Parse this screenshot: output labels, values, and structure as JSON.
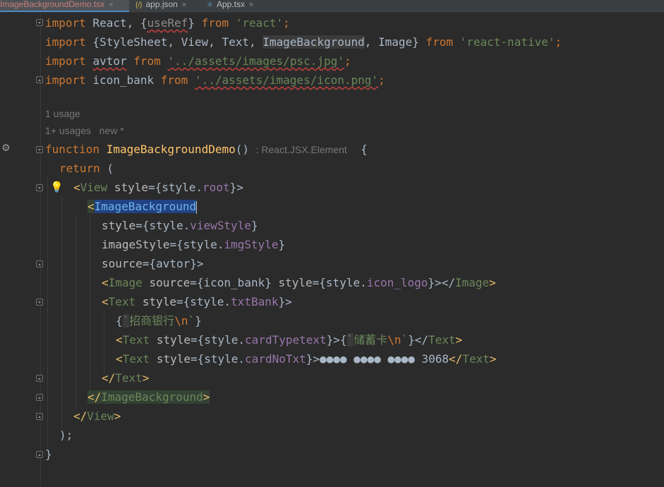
{
  "tabs": [
    {
      "label": "ImageBackgroundDemo.tsx",
      "active": true
    },
    {
      "label": "app.json",
      "active": false
    },
    {
      "label": "App.tsx",
      "active": false
    }
  ],
  "tab_close": "×",
  "hints": {
    "usage_1": "1 usage",
    "usage_2": "1+ usages",
    "new_author": "new *",
    "return_type": ": React.JSX.Element"
  },
  "code": {
    "l1": {
      "kw1": "import",
      "t1": " React, {",
      "id": "useRef",
      "t2": "} ",
      "kw2": "from",
      "t3": " ",
      "str": "'react'",
      "end": ";"
    },
    "l2": {
      "kw1": "import",
      "t1": " {StyleSheet, View, Text, ",
      "id": "ImageBackground",
      "t2": ", Image} ",
      "kw2": "from",
      "t3": " ",
      "str": "'react-native'",
      "end": ";"
    },
    "l3": {
      "kw1": "import",
      "t1": " ",
      "id": "avtor",
      "t2": " ",
      "kw2": "from",
      "t3": " ",
      "str": "'../assets/images/psc.jpg'",
      "end": ";"
    },
    "l4": {
      "kw1": "import",
      "t1": " icon_bank ",
      "kw2": "from",
      "t3": " ",
      "str": "'../assets/images/icon.png'",
      "end": ";"
    },
    "l5": {
      "kw": "function",
      "sp": " ",
      "fn": "ImageBackgroundDemo",
      "paren": "()",
      "brace": "{"
    },
    "l6": {
      "kw": "return",
      "rest": " ("
    },
    "l7": {
      "lt": "<",
      "tag": "View",
      "sp": " ",
      "attr": "style",
      "eq": "={style.",
      "prop": "root",
      "end": "}>"
    },
    "l8": {
      "lt": "<",
      "tag": "ImageBackground"
    },
    "l9": {
      "attr": "style",
      "eq": "={style.",
      "prop": "viewStyle",
      "end": "}"
    },
    "l10": {
      "attr": "imageStyle",
      "eq": "={style.",
      "prop": "imgStyle",
      "end": "}"
    },
    "l11": {
      "attr": "source",
      "eq": "={avtor}>"
    },
    "l12": {
      "lt": "<",
      "tag": "Image",
      "sp": " ",
      "attr1": "source",
      "eq1": "={icon_bank} ",
      "attr2": "style",
      "eq2": "={style.",
      "prop": "icon_logo",
      "mid": "}></",
      "tag2": "Image",
      "end": ">"
    },
    "l13": {
      "lt": "<",
      "tag": "Text",
      "sp": " ",
      "attr": "style",
      "eq": "={style.",
      "prop": "txtBank",
      "end": "}>"
    },
    "l14": {
      "open": "{",
      "tick": "`",
      "str": "招商银行",
      "esc": "\\n",
      "tick2": "`",
      "close": "}"
    },
    "l15": {
      "lt": "<",
      "tag": "Text",
      "sp": " ",
      "attr": "style",
      "eq": "={style.",
      "prop": "cardTypetext",
      "end": "}>{",
      "tick": "`",
      "str": "储蓄卡",
      "esc": "\\n",
      "tick2": "`",
      "close": "}</",
      "tag2": "Text",
      "gt": ">"
    },
    "l16": {
      "lt": "<",
      "tag": "Text",
      "sp": " ",
      "attr": "style",
      "eq": "={style.",
      "prop": "cardNoTxt",
      "end": "}>",
      "txt": "●●●● ●●●● ●●●● 3068",
      "close": "</",
      "tag2": "Text",
      "gt": ">"
    },
    "l17": {
      "lt": "</",
      "tag": "Text",
      "gt": ">"
    },
    "l18": {
      "lt": "</",
      "tag": "ImageBackground",
      "gt": ">"
    },
    "l19": {
      "lt": "</",
      "tag": "View",
      "gt": ">"
    },
    "l20": {
      "txt": ");"
    },
    "l21": {
      "txt": "}"
    }
  },
  "icons": {
    "bulb": "lightbulb-icon",
    "run": "run-config-icon",
    "fold": "fold-icon"
  },
  "colors": {
    "background": "#2b2b2b",
    "keyword": "#cc7832",
    "string": "#6a8759",
    "function": "#ffc66d",
    "tag": "#e8bf6a",
    "property": "#9876aa",
    "selection": "#214283"
  }
}
